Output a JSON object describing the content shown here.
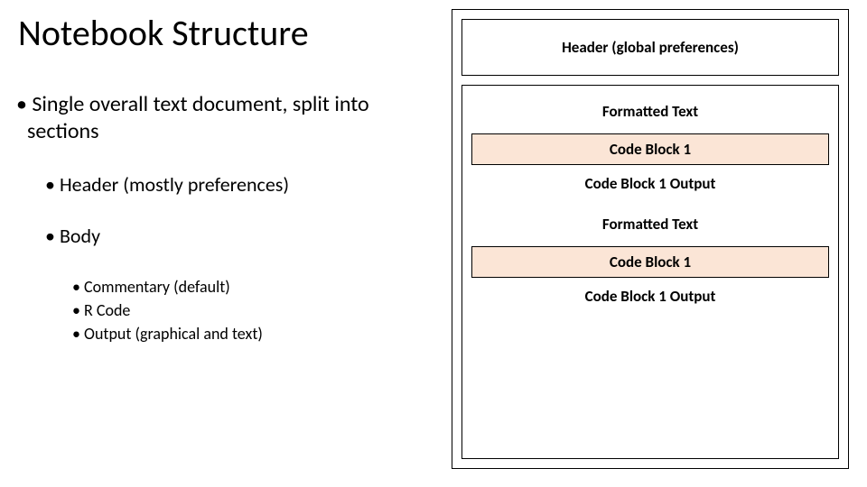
{
  "title": "Notebook Structure",
  "bullets": {
    "intro": "Single overall text document, split into sections",
    "header": "Header (mostly preferences)",
    "body_label": "Body",
    "body_items": {
      "commentary": "Commentary (default)",
      "rcode": "R Code",
      "output": "Output (graphical and text)"
    }
  },
  "diagram": {
    "header": "Header (global preferences)",
    "section1": {
      "formatted": "Formatted Text",
      "code": "Code Block 1",
      "output": "Code Block 1 Output"
    },
    "section2": {
      "formatted": "Formatted Text",
      "code": "Code Block 1",
      "output": "Code Block 1 Output"
    }
  }
}
